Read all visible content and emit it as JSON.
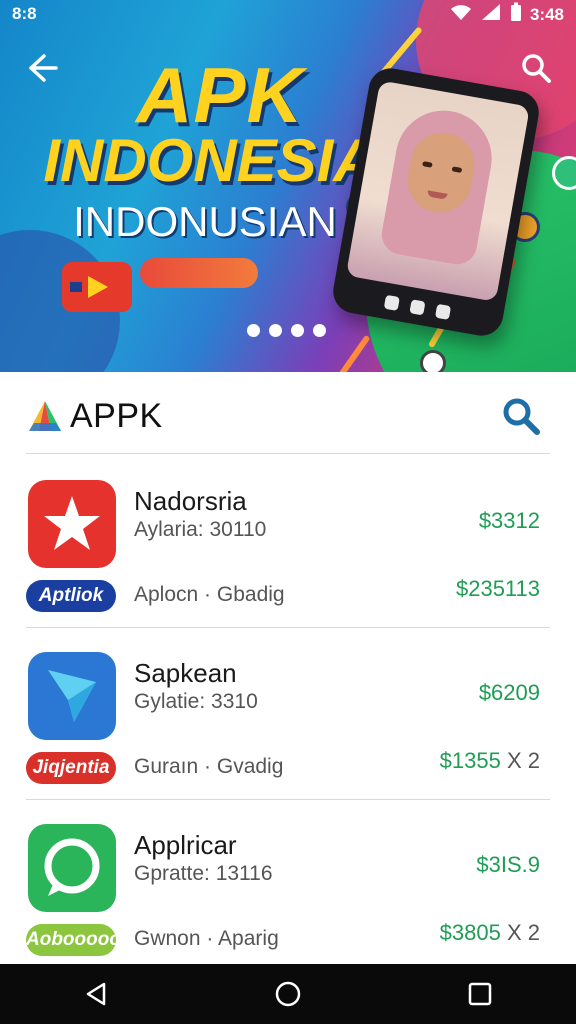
{
  "status_bar": {
    "time": "8:8",
    "clock": "3:48"
  },
  "hero": {
    "title_line1": "APK",
    "title_line2": "INDONESIA",
    "title_line3": "INDONUSIAN",
    "slides_count": 4,
    "active_slide": 0,
    "colors": {
      "title": "#ffd21f",
      "sky": "#1fa3d6",
      "accent_green": "#29c46a",
      "accent_pink": "#e2456f"
    }
  },
  "store": {
    "title": "APPK",
    "logo_colors": [
      "#e74c3c",
      "#f5b82e",
      "#2fbf6e",
      "#2a78d4"
    ],
    "search_icon": "search-icon",
    "accent": "#1d6fa8"
  },
  "apps": [
    {
      "name": "Nadorsria",
      "meta": "Aylaria: 30110",
      "tag": "Aptliok",
      "tag_color": "#1a3fa0",
      "sub": "Aplocn · Gbadig",
      "price_1": "$3312",
      "price_2": "$235113",
      "price_2_suffix": "",
      "icon": "star-icon",
      "icon_color": "#e5322d"
    },
    {
      "name": "Sapkean",
      "meta": "Gylatie: 3310",
      "tag": "Jiqjentia",
      "tag_color": "#d9302a",
      "sub": "Guraın · Gvadig",
      "price_1": "$6209",
      "price_2": "$1355",
      "price_2_suffix": "X 2",
      "icon": "paper-plane-icon",
      "icon_color": "#2a78d4"
    },
    {
      "name": "Applricar",
      "meta": "Gpratte: 13116",
      "tag": "Aobooooo",
      "tag_color": "#8cc63f",
      "sub": "Gwnon · Aparig",
      "price_1": "$3IS.9",
      "price_2": "$3805",
      "price_2_suffix": "X 2",
      "icon": "chat-bubble-icon",
      "icon_color": "#2ab55a"
    }
  ],
  "nav_bar": {
    "back": "back-triangle-icon",
    "home": "home-circle-icon",
    "recents": "recents-square-icon"
  }
}
